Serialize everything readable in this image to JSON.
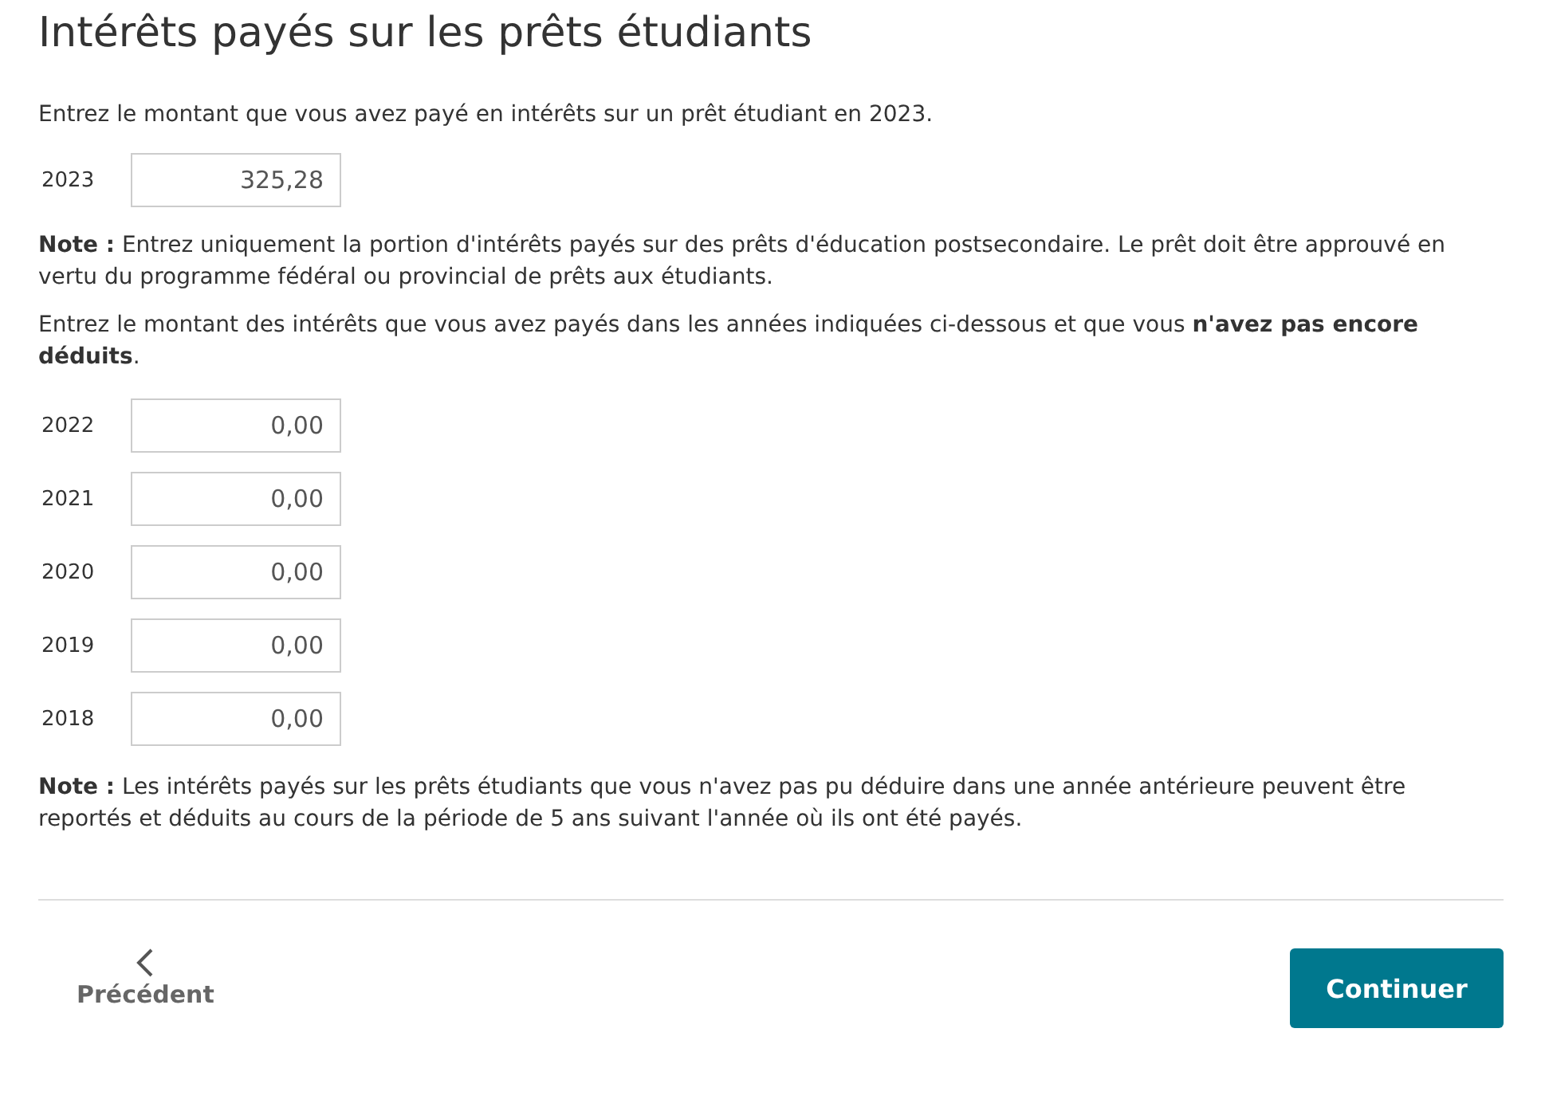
{
  "title": "Intérêts payés sur les prêts étudiants",
  "intro": "Entrez le montant que vous avez payé en intérêts sur un prêt étudiant en 2023.",
  "current_year": {
    "label": "2023",
    "value": "325,28"
  },
  "note_1": "**Note :** Entrez uniquement la portion d'intérêts payés sur des prêts d'éducation postsecondaire. Le prêt doit être approuvé en vertu du programme fédéral ou provincial de prêts aux étudiants.",
  "instruction": "Entrez le montant des intérêts que vous avez payés dans les années indiquées ci-dessous et que vous **n'avez pas encore déduits**.",
  "previous_years": [
    {
      "label": "2022",
      "value": "0,00"
    },
    {
      "label": "2021",
      "value": "0,00"
    },
    {
      "label": "2020",
      "value": "0,00"
    },
    {
      "label": "2019",
      "value": "0,00"
    },
    {
      "label": "2018",
      "value": "0,00"
    }
  ],
  "note_2": "**Note :** Les intérêts payés sur les prêts étudiants que vous n'avez pas pu déduire dans une année antérieure peuvent être reportés et déduits au cours de la période de 5 ans suivant l'année où ils ont été payés.",
  "back_button": "Précédent",
  "continue_button": "Continuer"
}
